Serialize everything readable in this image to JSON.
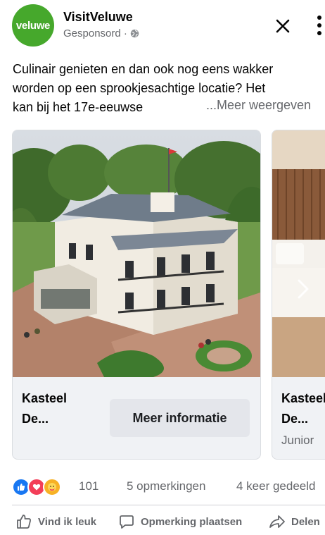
{
  "header": {
    "avatar_text": "veluwe",
    "page_name": "VisitVeluwe",
    "sponsored_label": "Gesponsord · ",
    "globe_icon": "globe-icon",
    "close_icon": "close-icon",
    "more_icon": "more-vertical-icon"
  },
  "post": {
    "lines": [
      "Culinair genieten en dan ook nog eens wakker",
      "worden op een sprookjesachtige locatie? Het",
      "kan bij het 17e-eeuwse"
    ],
    "see_more": "...Meer weergeven"
  },
  "carousel": {
    "cards": [
      {
        "title_line1": "Kasteel",
        "title_line2": "De...",
        "subtitle": "",
        "cta_label": "Meer informatie",
        "image": "castle-photo"
      },
      {
        "title_line1": "Kasteel",
        "title_line2": "De...",
        "subtitle": "Junior",
        "cta_label": "",
        "image": "hotel-room-photo"
      }
    ],
    "next_icon": "chevron-right-icon"
  },
  "stats": {
    "reaction_icons": [
      "like-icon",
      "love-icon",
      "care-icon"
    ],
    "reaction_count": "101",
    "comments": "5 opmerkingen",
    "shares": "4 keer gedeeld"
  },
  "actions": {
    "like": "Vind ik leuk",
    "comment": "Opmerking plaatsen",
    "share": "Delen"
  },
  "colors": {
    "brand_green": "#46a82c",
    "like_blue": "#1877f2",
    "love_red": "#f33e58",
    "care_yellow": "#f7b125",
    "secondary_text": "#65676b"
  }
}
